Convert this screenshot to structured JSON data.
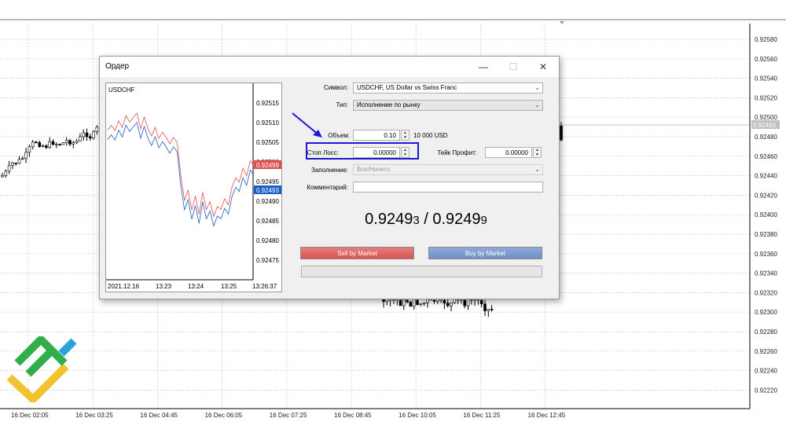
{
  "background_chart": {
    "price_axis": [
      "0.92580",
      "0.92560",
      "0.92540",
      "0.92520",
      "0.92500",
      "0.92480",
      "0.92460",
      "0.92440",
      "0.92420",
      "0.92400",
      "0.92380",
      "0.92360",
      "0.92340",
      "0.92320",
      "0.92300",
      "0.92280",
      "0.92260",
      "0.92240",
      "0.92220"
    ],
    "current_price_tag": "0.92493",
    "time_axis": [
      "16 Dec 02:05",
      "16 Dec 03:25",
      "16 Dec 04:45",
      "16 Dec 06:05",
      "16 Dec 07:25",
      "16 Dec 08:45",
      "16 Dec 10:05",
      "16 Dec 11:25",
      "16 Dec 12:45"
    ],
    "candle_color": "#000000",
    "grid_color": "#c8c8c8"
  },
  "dialog": {
    "title": "Ордер",
    "minimize_icon": "—",
    "maximize_icon": "☐",
    "close_icon": "✕",
    "mini_chart": {
      "symbol": "USDCHF",
      "price_axis": [
        "0.92515",
        "0.92510",
        "0.92505",
        "0.92500",
        "0.92495",
        "0.92490",
        "0.92485",
        "0.92480",
        "0.92475"
      ],
      "time_axis": [
        "2021.12.16",
        "13:23",
        "13:24",
        "13:25",
        "13:26:37"
      ],
      "ask_tag": "0.92499",
      "bid_tag": "0.92493",
      "ask_color": "#e05050",
      "bid_color": "#1a5fc8"
    },
    "form": {
      "symbol_label": "Символ:",
      "symbol_value": "USDCHF, US Dollar vs Swiss Franc",
      "type_label": "Тип:",
      "type_value": "Исполнение по рынку",
      "volume_label": "Объем:",
      "volume_value": "0.10",
      "volume_note": "10 000 USD",
      "stoploss_label": "Стоп Лосс:",
      "stoploss_value": "0.00000",
      "takeprofit_label": "Тейк Профит:",
      "takeprofit_value": "0.00000",
      "filling_label": "Заполнение:",
      "filling_value": "Все/Ничего",
      "comment_label": "Комментарий:",
      "comment_value": ""
    },
    "quote": {
      "bid_main": "0.9249",
      "bid_small": "3",
      "separator": " / ",
      "ask_main": "0.9249",
      "ask_small": "9"
    },
    "sell_button": "Sell by Market",
    "buy_button": "Buy by Market",
    "sell_color": "#d9534f",
    "buy_color": "#6f8fc9",
    "annotation_color": "#1c16d6"
  }
}
